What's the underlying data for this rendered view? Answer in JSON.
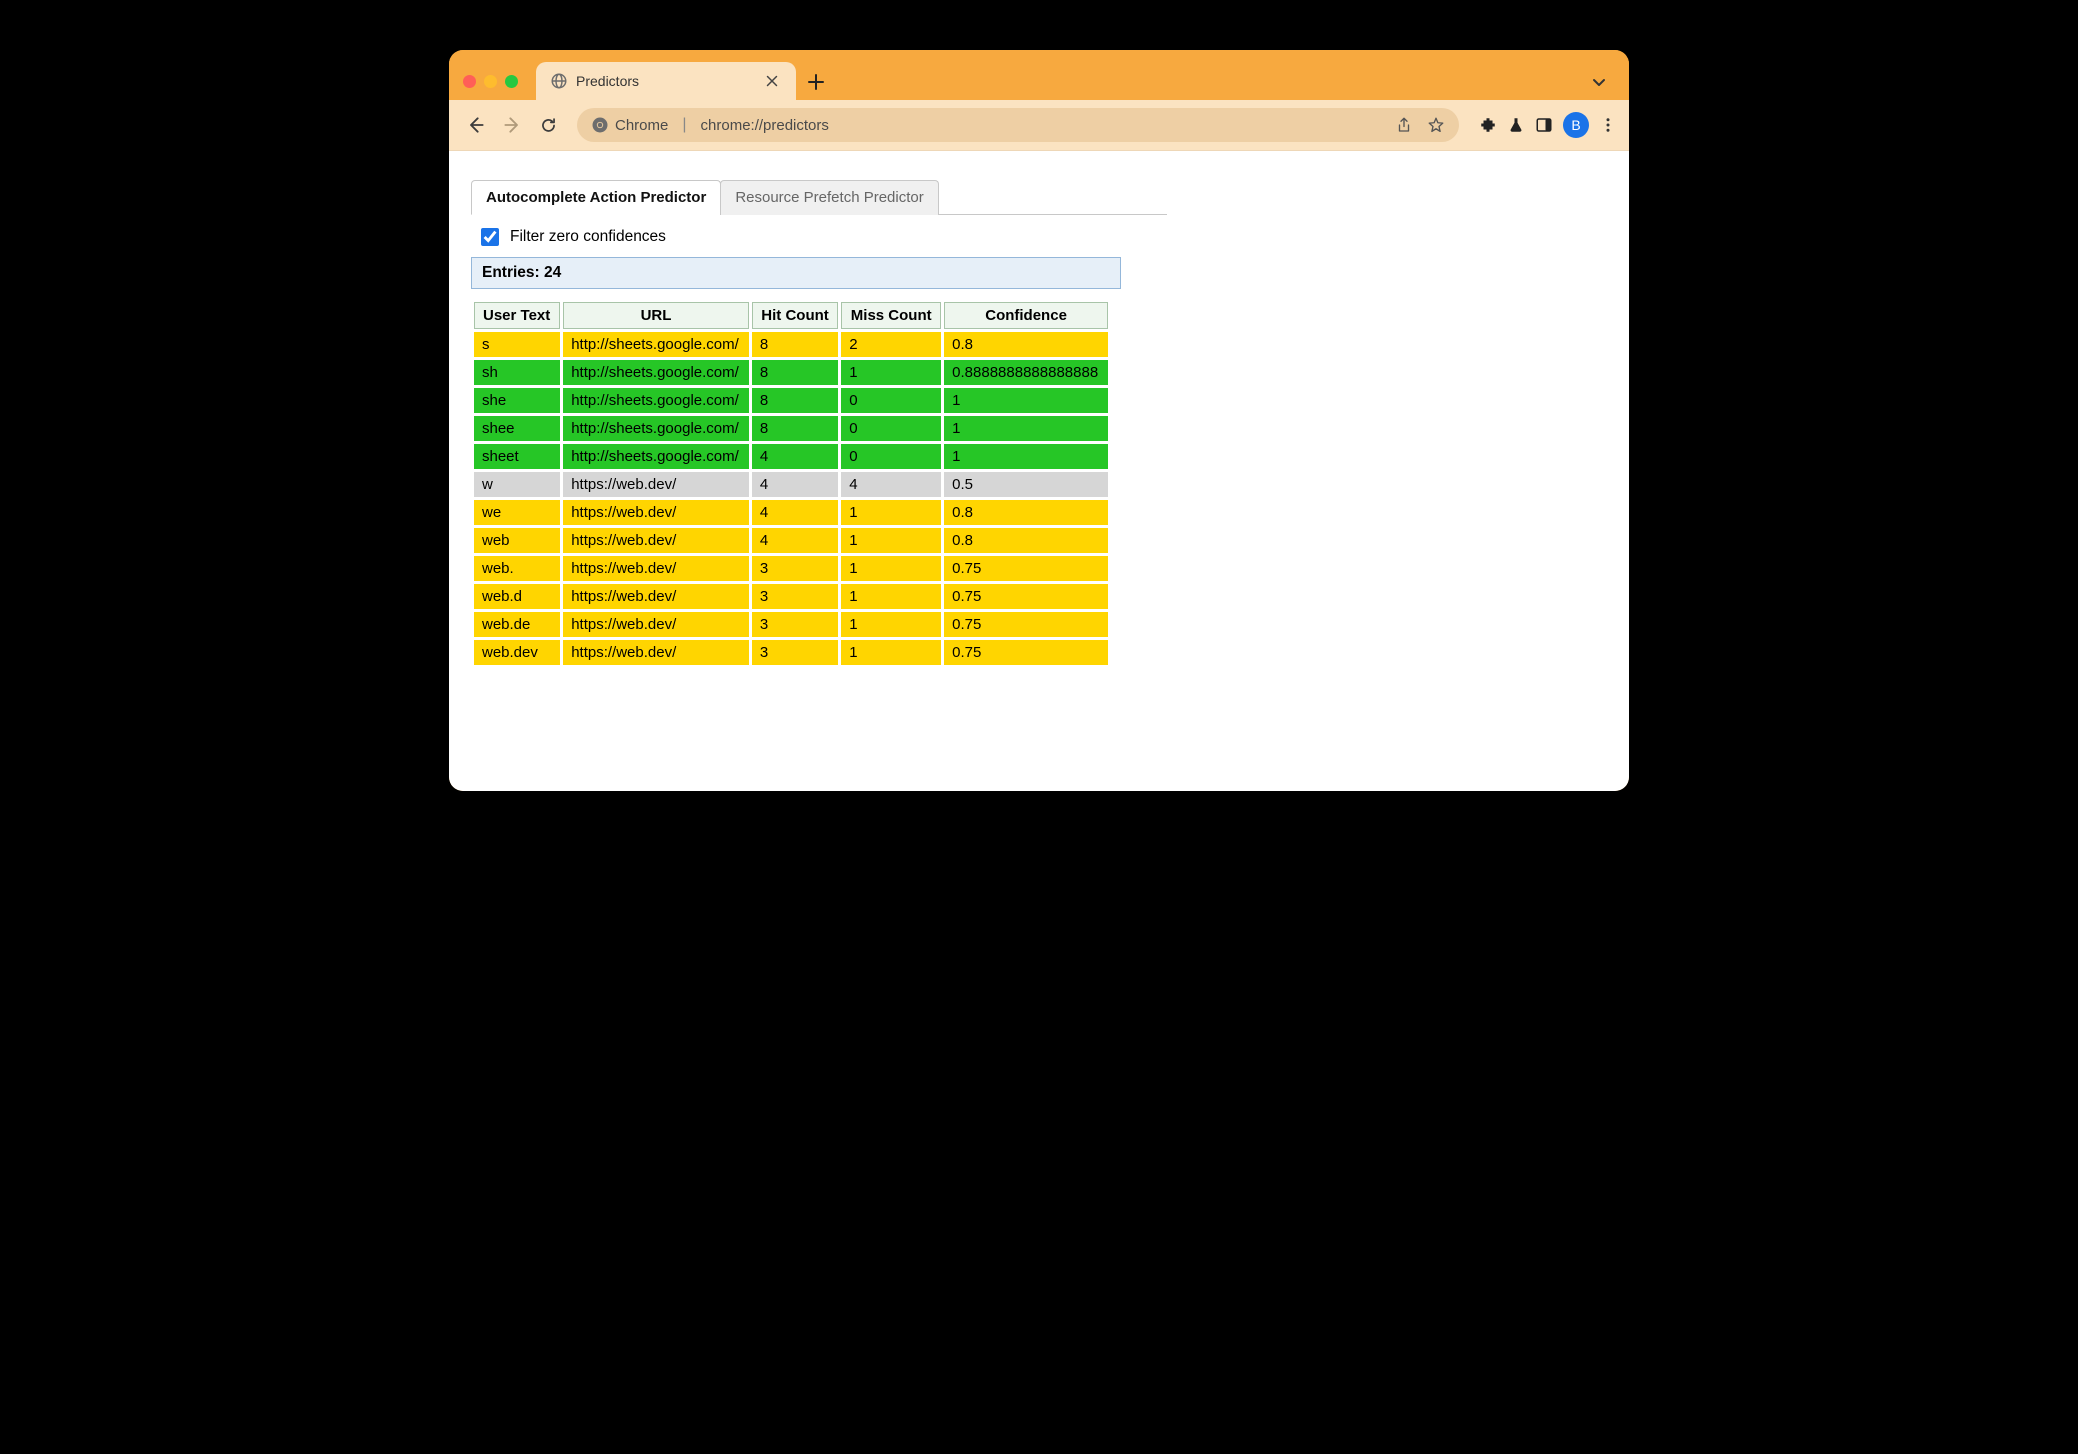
{
  "window": {
    "tab_title": "Predictors",
    "omnibox": {
      "scheme_label": "Chrome",
      "url": "chrome://predictors"
    },
    "avatar_initial": "B"
  },
  "tabs": {
    "active_label": "Autocomplete Action Predictor",
    "inactive_label": "Resource Prefetch Predictor"
  },
  "filter": {
    "label": "Filter zero confidences",
    "checked": true
  },
  "entries_heading": "Entries: 24",
  "columns": {
    "user_text": "User Text",
    "url": "URL",
    "hit_count": "Hit Count",
    "miss_count": "Miss Count",
    "confidence": "Confidence"
  },
  "rows": [
    {
      "user_text": "s",
      "url": "http://sheets.google.com/",
      "hit": "8",
      "miss": "2",
      "confidence": "0.8",
      "tone": "yellow"
    },
    {
      "user_text": "sh",
      "url": "http://sheets.google.com/",
      "hit": "8",
      "miss": "1",
      "confidence": "0.8888888888888888",
      "tone": "green"
    },
    {
      "user_text": "she",
      "url": "http://sheets.google.com/",
      "hit": "8",
      "miss": "0",
      "confidence": "1",
      "tone": "green"
    },
    {
      "user_text": "shee",
      "url": "http://sheets.google.com/",
      "hit": "8",
      "miss": "0",
      "confidence": "1",
      "tone": "green"
    },
    {
      "user_text": "sheet",
      "url": "http://sheets.google.com/",
      "hit": "4",
      "miss": "0",
      "confidence": "1",
      "tone": "green"
    },
    {
      "user_text": "w",
      "url": "https://web.dev/",
      "hit": "4",
      "miss": "4",
      "confidence": "0.5",
      "tone": "gray"
    },
    {
      "user_text": "we",
      "url": "https://web.dev/",
      "hit": "4",
      "miss": "1",
      "confidence": "0.8",
      "tone": "yellow"
    },
    {
      "user_text": "web",
      "url": "https://web.dev/",
      "hit": "4",
      "miss": "1",
      "confidence": "0.8",
      "tone": "yellow"
    },
    {
      "user_text": "web.",
      "url": "https://web.dev/",
      "hit": "3",
      "miss": "1",
      "confidence": "0.75",
      "tone": "yellow"
    },
    {
      "user_text": "web.d",
      "url": "https://web.dev/",
      "hit": "3",
      "miss": "1",
      "confidence": "0.75",
      "tone": "yellow"
    },
    {
      "user_text": "web.de",
      "url": "https://web.dev/",
      "hit": "3",
      "miss": "1",
      "confidence": "0.75",
      "tone": "yellow"
    },
    {
      "user_text": "web.dev",
      "url": "https://web.dev/",
      "hit": "3",
      "miss": "1",
      "confidence": "0.75",
      "tone": "yellow"
    }
  ]
}
